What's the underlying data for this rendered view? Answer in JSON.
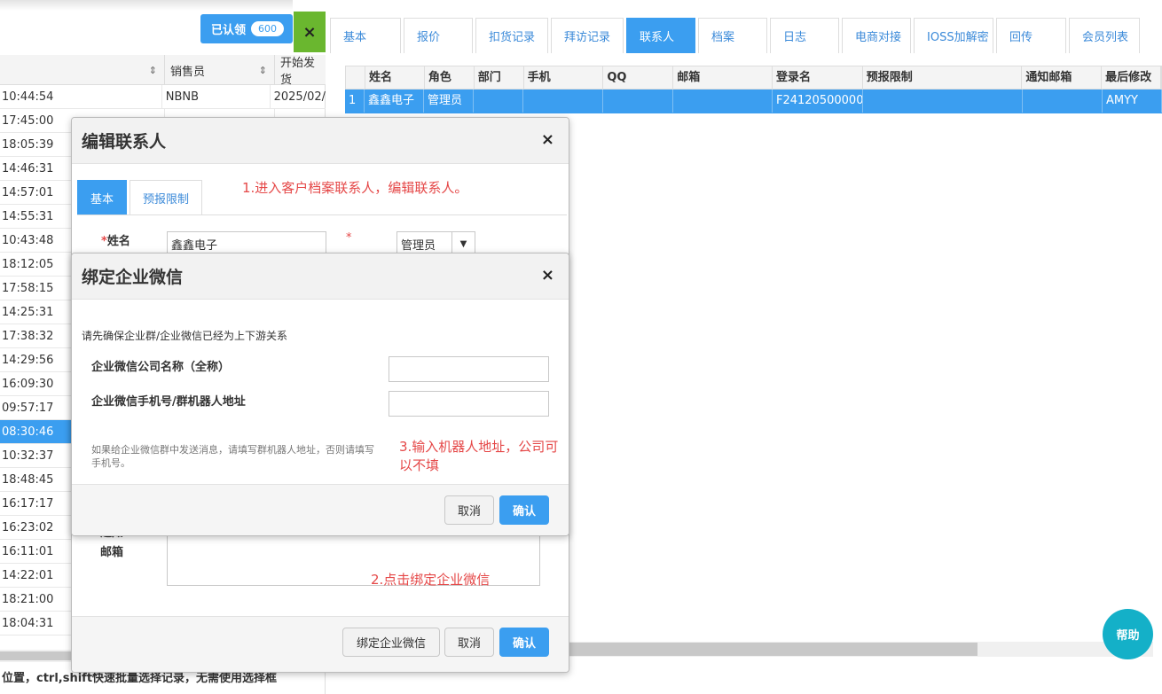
{
  "left_panel": {
    "claimed_label": "已认领",
    "claimed_count": "600",
    "close_glyph": "×",
    "headers": {
      "salesperson": "销售员",
      "start_ship": "开始发货"
    },
    "sort_glyph": "⇕",
    "rows": [
      {
        "time": "10:44:54",
        "sales": "NBNB",
        "date": "2025/02/"
      },
      {
        "time": "17:45:00",
        "sales": "",
        "date": ""
      },
      {
        "time": "18:05:39",
        "sales": "",
        "date": ""
      },
      {
        "time": "14:46:31",
        "sales": "",
        "date": ""
      },
      {
        "time": "14:57:01",
        "sales": "",
        "date": ""
      },
      {
        "time": "14:55:31",
        "sales": "",
        "date": ""
      },
      {
        "time": "10:43:48",
        "sales": "",
        "date": ""
      },
      {
        "time": "18:12:05",
        "sales": "",
        "date": ""
      },
      {
        "time": "17:58:15",
        "sales": "",
        "date": ""
      },
      {
        "time": "14:25:31",
        "sales": "",
        "date": ""
      },
      {
        "time": "17:38:32",
        "sales": "",
        "date": ""
      },
      {
        "time": "14:29:56",
        "sales": "",
        "date": ""
      },
      {
        "time": "16:09:30",
        "sales": "",
        "date": ""
      },
      {
        "time": "09:57:17",
        "sales": "",
        "date": ""
      },
      {
        "time": "08:30:46",
        "sales": "",
        "date": "",
        "selected": true
      },
      {
        "time": "10:32:37",
        "sales": "",
        "date": ""
      },
      {
        "time": "18:48:45",
        "sales": "",
        "date": ""
      },
      {
        "time": "16:17:17",
        "sales": "",
        "date": ""
      },
      {
        "time": "16:23:02",
        "sales": "",
        "date": ""
      },
      {
        "time": "16:11:01",
        "sales": "",
        "date": ""
      },
      {
        "time": "14:22:01",
        "sales": "",
        "date": ""
      },
      {
        "time": "18:21:00",
        "sales": "",
        "date": ""
      },
      {
        "time": "18:04:31",
        "sales": "",
        "date": ""
      }
    ],
    "footer_text": "位置，ctrl,shift快速批量选择记录，无需使用选择框"
  },
  "right_panel": {
    "tabs": [
      {
        "label": "基本",
        "w": 80
      },
      {
        "label": "报价",
        "w": 78
      },
      {
        "label": "扣货记录",
        "w": 82
      },
      {
        "label": "拜访记录",
        "w": 82
      },
      {
        "label": "联系人",
        "w": 78,
        "active": true
      },
      {
        "label": "档案",
        "w": 78
      },
      {
        "label": "日志",
        "w": 78
      },
      {
        "label": "电商对接",
        "w": 78
      },
      {
        "label": "IOSS加解密",
        "w": 90
      },
      {
        "label": "回传",
        "w": 79
      },
      {
        "label": "会员列表",
        "w": 80
      }
    ],
    "table_headers": [
      "",
      "姓名",
      "角色",
      "部门",
      "手机",
      "QQ",
      "邮箱",
      "登录名",
      "预报限制",
      "通知邮箱",
      "最后修改"
    ],
    "row": [
      "1",
      "鑫鑫电子",
      "管理员",
      "",
      "",
      "",
      "",
      "F24120500000",
      "",
      "",
      "AMYY"
    ],
    "help_label": "帮助"
  },
  "edit_dialog": {
    "title": "编辑联系人",
    "close_glyph": "×",
    "tabs": [
      "基本",
      "预报限制"
    ],
    "annotation_1": "1.进入客户档案联系人，编辑联系人。",
    "name_label": "姓名",
    "required_mark": "*",
    "name_value": "鑫鑫电子",
    "role_value": "管理员",
    "role_arrow": "▼",
    "notify_label": "通知邮箱",
    "annotation_2": "2.点击绑定企业微信",
    "bind_button": "绑定企业微信",
    "cancel_button": "取消",
    "confirm_button": "确认"
  },
  "bind_dialog": {
    "title": "绑定企业微信",
    "close_glyph": "×",
    "hint": "请先确保企业群/企业微信已经为上下游关系",
    "company_label": "企业微信公司名称（全称）",
    "company_value": "",
    "phone_label": "企业微信手机号/群机器人地址",
    "phone_value": "",
    "note": "如果给企业微信群中发送消息，请填写群机器人地址，否则请填写手机号。",
    "annotation_3": "3.输入机器人地址，公司可以不填",
    "cancel_button": "取消",
    "confirm_button": "确认"
  }
}
